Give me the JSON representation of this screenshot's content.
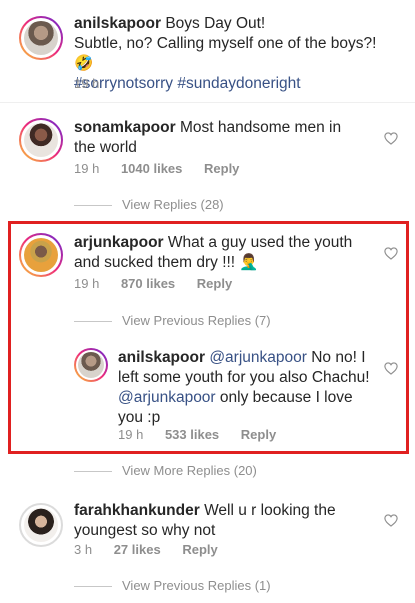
{
  "caption": {
    "username": "anilskapoor",
    "text_line1": "Boys Day Out!",
    "text_line2": "Subtle, no? Calling myself one of the boys?!",
    "emoji": "🤣",
    "hashtags": "#sorrynotsorry #sundaydoneright",
    "time": "19 h"
  },
  "comments": [
    {
      "username": "sonamkapoor",
      "text": "Most handsome men in the world",
      "time": "19 h",
      "likes": "1040 likes",
      "reply": "Reply",
      "view_replies": "View Replies (28)"
    },
    {
      "username": "arjunkapoor",
      "text": "What a guy used the youth and sucked them dry !!!",
      "emoji": "🤦‍♂️",
      "time": "19 h",
      "likes": "870 likes",
      "reply": "Reply",
      "view_replies": "View Previous Replies (7)",
      "nested_reply": {
        "username": "anilskapoor",
        "mention1": "@arjunkapoor",
        "text1": "No no! I left some youth for you also Chachu!",
        "mention2": "@arjunkapoor",
        "text2": "only because I love you :p",
        "time": "19 h",
        "likes": "533 likes",
        "reply": "Reply"
      },
      "view_more_replies": "View More Replies (20)"
    },
    {
      "username": "farahkhankunder",
      "text": "Well u r looking the youngest so why not",
      "time": "3 h",
      "likes": "27 likes",
      "reply": "Reply",
      "view_replies": "View Previous Replies (1)"
    }
  ],
  "colors": {
    "text": "#262626",
    "meta": "#8e8e8e",
    "link": "#385185",
    "highlight_border": "#e02020"
  },
  "icons": [
    "heart-outline-icon",
    "avatar"
  ]
}
